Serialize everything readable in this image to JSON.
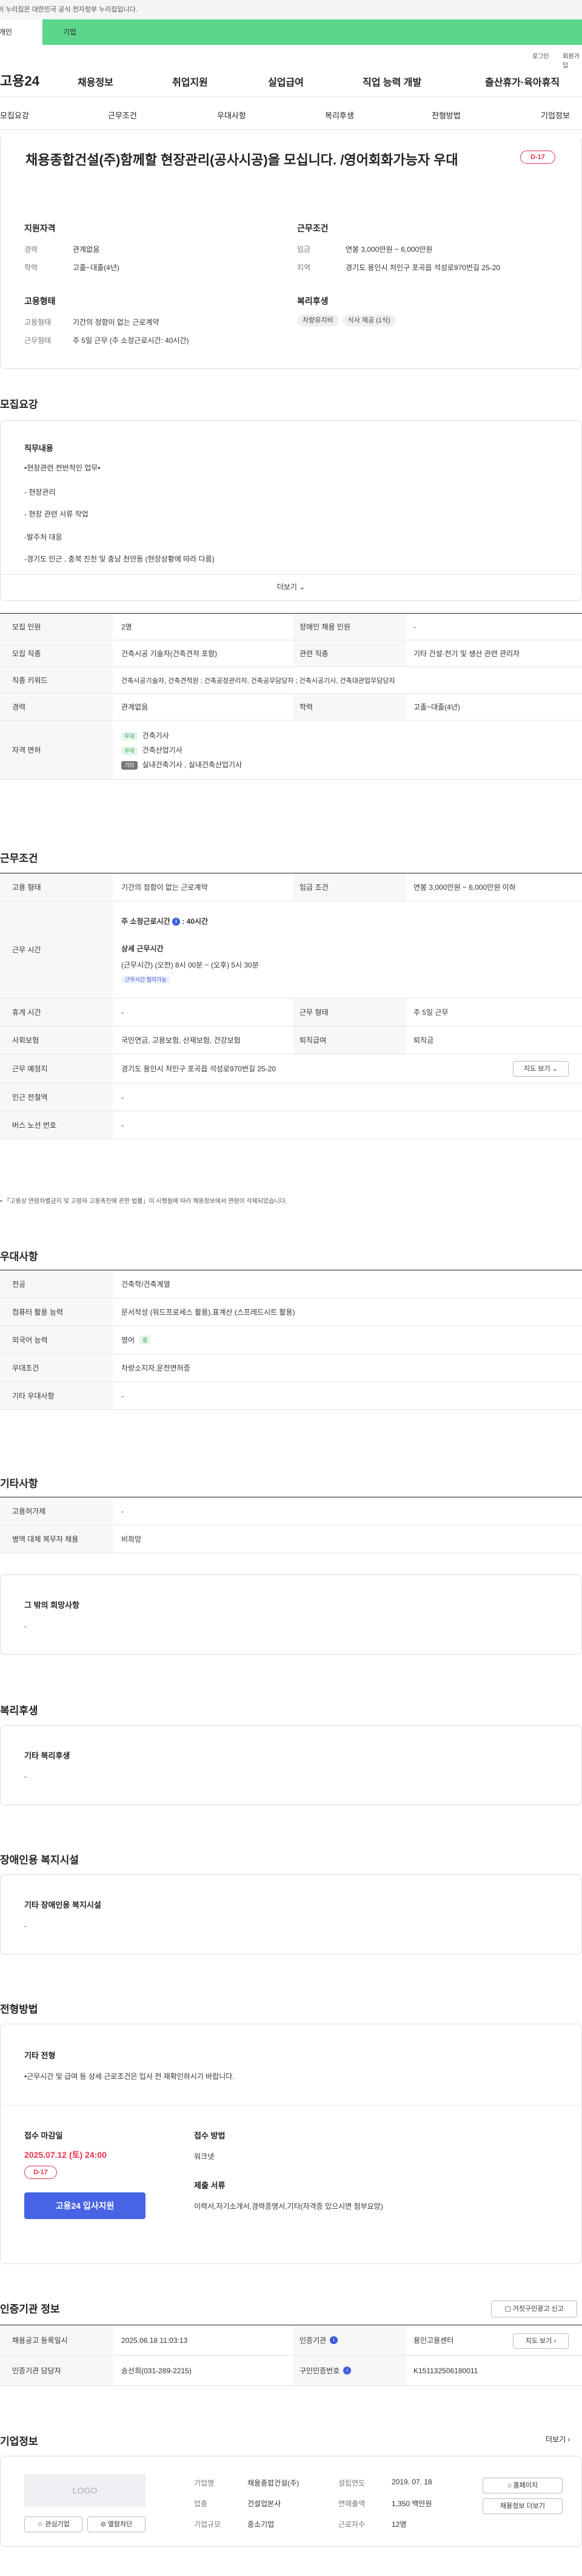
{
  "gov_banner": "이 누리집은 대한민국 공식 전자정부 누리집입니다.",
  "top_tabs": [
    "개인",
    "기업"
  ],
  "util": {
    "login": "로그인",
    "join": "회원가입"
  },
  "logo": "고용24",
  "gnb": [
    "채용정보",
    "취업지원",
    "실업급여",
    "직업 능력 개발",
    "출산휴가·육아휴직"
  ],
  "snb": [
    "모집요강",
    "근무조건",
    "우대사항",
    "복리후생",
    "전형방법",
    "기업정보"
  ],
  "title": "채용종합건설(주)함께할 현장관리(공사시공)을 모십니다. /영어회화가능자 우대",
  "dday": "D-17",
  "summary": {
    "qual_h": "지원자격",
    "career_l": "경력",
    "career_v": "관계없음",
    "edu_l": "학력",
    "edu_v": "고졸~대졸(4년)",
    "cond_h": "근무조건",
    "wage_l": "임금",
    "wage_v": "연봉 3,000만원 ~ 6,000만원",
    "loc_l": "지역",
    "loc_v": "경기도 용인시 처인구 포곡읍 석성로970번길 25-20",
    "emp_h": "고용형태",
    "emptype_l": "고용형태",
    "emptype_v": "기간의 정함이 없는 근로계약",
    "worktype_l": "근무형태",
    "worktype_v": "주 5일 근무 (주 소정근로시간: 40시간)",
    "welfare_h": "복리후생",
    "welfare_chips": [
      "차량유지비",
      "식사 제공 (1식)"
    ]
  },
  "recruit": {
    "h": "모집요강",
    "duty_h": "직무내용",
    "duty_lines": [
      "•현장관련 전반적인 업무•",
      "- 현장관리",
      "- 현장 관련 서류 작업",
      "-발주처 대응",
      "-경기도 인근 , 충북 진천 및 충남 천안등 (현장상황에 따라 다름)"
    ],
    "more": "더보기",
    "rows": [
      {
        "l": "모집 인원",
        "v": "2명",
        "l2": "장애인 채용 인원",
        "v2": "-"
      },
      {
        "l": "모집 직종",
        "v": "건축시공 기술자(건축견적 포함)",
        "l2": "관련 직종",
        "v2": "기타 건설·전기 및 생산 관련 관리자"
      },
      {
        "l": "직종 키워드",
        "v": "건축시공기술자, 건축견적원 ; 건축공정관리자, 건축공무담당자 ; 건축시공기사, 건축대관업무담당자"
      },
      {
        "l": "경력",
        "v": "관계없음",
        "l2": "학력",
        "v2": "고졸~대졸(4년)"
      }
    ],
    "license_l": "자격 면허",
    "licenses": [
      {
        "b": "우대",
        "t": "건축기사"
      },
      {
        "b": "우대",
        "t": "건축산업기사"
      },
      {
        "b": "기타",
        "t": "실내건축기사 , 실내건축산업기사"
      }
    ]
  },
  "work": {
    "h": "근무조건",
    "r1": {
      "l": "고용 형태",
      "v": "기간의 정함이 없는 근로계약",
      "l2": "임금 조건",
      "v2": "연봉 3,000만원 ~ 6,000만원 이하"
    },
    "time_l": "근무 시간",
    "time_main": "주 소정근로시간",
    "time_hours": "40시간",
    "time_detail_h": "상세 근무시간",
    "time_detail": "(근무시간) (오전) 8시 00분 ~ (오후) 5시 30분",
    "time_tip": "근무시간 협의가능",
    "r3": {
      "l": "휴게 시간",
      "v": "-",
      "l2": "근무 형태",
      "v2": "주 5일 근무"
    },
    "r4": {
      "l": "사회보험",
      "v": "국민연금, 고용보험, 산재보험, 건강보험",
      "l2": "퇴직급여",
      "v2": "퇴직금"
    },
    "r5": {
      "l": "근무 예정지",
      "v": "경기도 용인시 처인구 포곡읍 석성로970번길 25-20",
      "btn": "지도 보기"
    },
    "r6": {
      "l": "인근 전철역",
      "v": "-"
    },
    "r7": {
      "l": "버스 노선 번호",
      "v": "-"
    },
    "note": "「고용상 연령차별금지 및 고령자 고용촉진에 관한 법률」이 시행됨에 따라 채용정보에서 연령이 삭제되었습니다."
  },
  "pref": {
    "h": "우대사항",
    "rows": [
      {
        "l": "전공",
        "v": "건축학/건축계열"
      },
      {
        "l": "컴퓨터 활용 능력",
        "v": "문서작성 (워드프로세스 활용),표계산 (스프레드시트 활용)"
      },
      {
        "l": "외국어 능력",
        "v": "영어",
        "badge": "중"
      },
      {
        "l": "우대조건",
        "v": "차량소지자,운전면허증"
      },
      {
        "l": "기타 우대사항",
        "v": "-"
      }
    ]
  },
  "etc": {
    "h": "기타사항",
    "rows": [
      {
        "l": "고용허가제",
        "v": "-"
      },
      {
        "l": "병역 대체 복무자 채용",
        "v": "비희망"
      }
    ],
    "wish_h": "그 밖의 희망사항",
    "wish_v": "-"
  },
  "welfare": {
    "h": "복리후생",
    "sub": "기타 복리후생",
    "v": "-"
  },
  "disab": {
    "h": "장애인용 복지시설",
    "sub": "기타 장애인용 복지시설",
    "v": "-"
  },
  "selection": {
    "h": "전형방법",
    "sub": "기타 전형",
    "v": "•근무시간 및 급여 등 상세 근로조건은 입사 전 재확인하시기 바랍니다.",
    "deadline_h": "접수 마감일",
    "deadline": "2025.07.12 (토) 24:00",
    "dday": "D-17",
    "apply": "고용24 입사지원",
    "method_h": "접수 방법",
    "method_v": "워크넷",
    "docs_h": "제출 서류",
    "docs_v": "이력서,자기소개서,경력증명서,기타(자격증 있으시면 첨부요망)"
  },
  "cert": {
    "h": "인증기관 정보",
    "report": "거짓구인광고 신고",
    "r1": {
      "l": "채용공고 등록일시",
      "v": "2025.06.18 11:03:13",
      "l2": "인증기관",
      "v2": "용인고용센터",
      "btn": "지도 보기"
    },
    "r2": {
      "l": "인증기관 담당자",
      "v": "송선희(031-289-2215)",
      "l2": "구인인증번호",
      "v2": "K151132506180011"
    }
  },
  "company": {
    "h": "기업정보",
    "more": "더보기",
    "logo": "LOGO",
    "fav": "관심기업",
    "block": "열람차단",
    "name_l": "기업명",
    "name_v": "채용종합건설(주)",
    "est_l": "설립연도",
    "est_v": "2019. 07. 18",
    "ind_l": "업종",
    "ind_v": "건설업본사",
    "sales_l": "연매출액",
    "sales_v": "1,350 백만원",
    "size_l": "기업규모",
    "size_v": "중소기업",
    "emp_l": "근로자수",
    "emp_v": "12명",
    "home": "홈페이지",
    "other": "채용정보 더보기"
  }
}
